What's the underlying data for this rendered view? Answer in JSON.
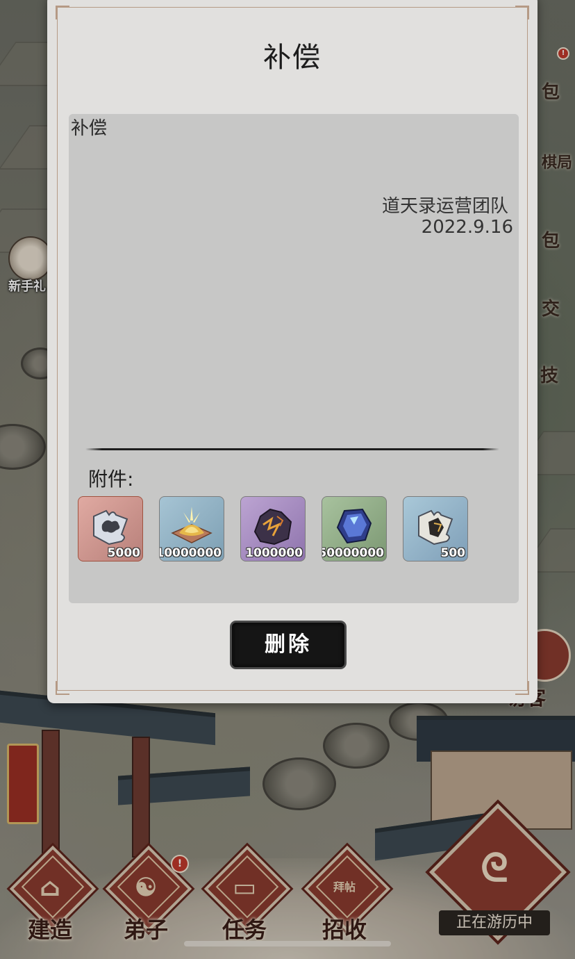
{
  "mail": {
    "title": "补偿",
    "subject": "补偿",
    "sender": "道天录运营团队",
    "date": "2022.9.16",
    "attachments_label": "附件:",
    "attachments": [
      {
        "icon": "puzzle-cloud-icon",
        "count": "5000",
        "bg": "#d39b94"
      },
      {
        "icon": "gold-powder-icon",
        "count": "10000000",
        "bg": "#8fb1c4"
      },
      {
        "icon": "dark-crystal-ore-icon",
        "count": "1000000",
        "bg": "#a98fc2"
      },
      {
        "icon": "blue-gem-icon",
        "count": "50000000",
        "bg": "#8eaa86"
      },
      {
        "icon": "puzzle-figure-icon",
        "count": "500",
        "bg": "#96b6c9"
      }
    ],
    "delete_label": "删除"
  },
  "background": {
    "left_npc_label": "新手礼",
    "side_labels": [
      "包",
      "棋局",
      "包",
      "交",
      "技"
    ],
    "visitor_label": "访客",
    "nav": [
      {
        "label": "建造",
        "icon": "building-icon",
        "glyph": "⌂"
      },
      {
        "label": "弟子",
        "icon": "disciple-icon",
        "glyph": "☯",
        "badge": "!"
      },
      {
        "label": "任务",
        "icon": "scroll-task-icon",
        "glyph": "▭"
      },
      {
        "label": "招收",
        "icon": "recruit-card-icon",
        "glyph": "拜帖"
      }
    ],
    "travel_label": "正在游历中",
    "travel_glyph": "ᘓ",
    "badge": "!"
  }
}
